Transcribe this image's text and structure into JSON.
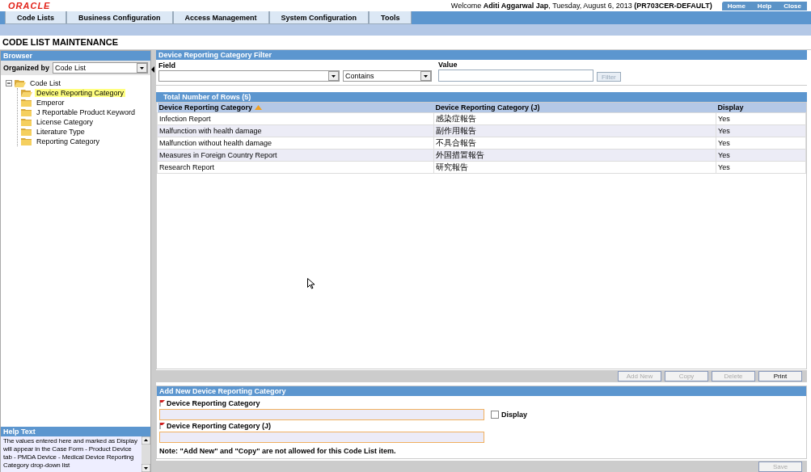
{
  "header": {
    "logo": "ORACLE",
    "welcome": "Welcome **Aditi Aggarwal Jap**, Tuesday, August 6, 2013 **(PR703CER-DEFAULT)**",
    "links": [
      "Home",
      "Help",
      "Close"
    ]
  },
  "menu": [
    "Code Lists",
    "Business Configuration",
    "Access Management",
    "System Configuration",
    "Tools"
  ],
  "page_title": "CODE LIST MAINTENANCE",
  "browser": {
    "title": "Browser",
    "organized_by_label": "Organized by",
    "organized_by_value": "Code List",
    "tree": [
      {
        "label": "Code List",
        "expanded": true,
        "selected": false,
        "children": [
          {
            "label": "Device Reporting Category",
            "selected": true
          },
          {
            "label": "Emperor",
            "selected": false
          },
          {
            "label": "J Reportable Product Keyword",
            "selected": false
          },
          {
            "label": "License Category",
            "selected": false
          },
          {
            "label": "Literature Type",
            "selected": false
          },
          {
            "label": "Reporting Category",
            "selected": false
          }
        ]
      }
    ]
  },
  "help": {
    "title": "Help Text",
    "text": "The values entered here and marked as Display will appear in the Case Form - Product Device tab - PMDA Device - Medical Device Reporting Category drop-down list"
  },
  "filter": {
    "title": "Device Reporting Category Filter",
    "field_label": "Field",
    "operator": "Contains",
    "value_label": "Value",
    "filter_button": {
      "label": "Filter",
      "disabled": true
    }
  },
  "table": {
    "title": "Total Number of Rows (5)",
    "columns": [
      {
        "label": "Device Reporting Category",
        "sorted": true
      },
      {
        "label": "Device Reporting Category (J)",
        "sorted": false
      },
      {
        "label": "Display",
        "sorted": false
      }
    ],
    "rows": [
      [
        "Infection Report",
        "感染症報告",
        "Yes"
      ],
      [
        "Malfunction with health damage",
        "副作用報告",
        "Yes"
      ],
      [
        "Malfunction without health damage",
        "不具合報告",
        "Yes"
      ],
      [
        "Measures in Foreign Country Report",
        "外国措置報告",
        "Yes"
      ],
      [
        "Research Report",
        "研究報告",
        "Yes"
      ]
    ]
  },
  "actions": [
    {
      "label": "Add New",
      "disabled": true
    },
    {
      "label": "Copy",
      "disabled": true
    },
    {
      "label": "Delete",
      "disabled": true
    },
    {
      "label": "Print",
      "disabled": false
    }
  ],
  "add_form": {
    "title": "Add New Device Reporting Category",
    "fields": [
      {
        "label": "Device Reporting Category",
        "required": true
      },
      {
        "label": "Device Reporting Category (J)",
        "required": true
      }
    ],
    "display_checkbox": {
      "label": "Display",
      "checked": false
    },
    "note": "Note: \"Add New\" and \"Copy\" are not allowed for this Code List item.",
    "save_button": {
      "label": "Save",
      "disabled": true
    }
  }
}
